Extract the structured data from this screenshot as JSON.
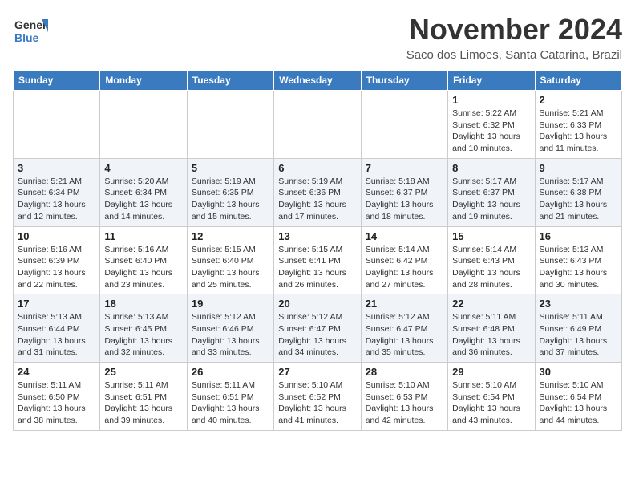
{
  "header": {
    "logo_line1": "General",
    "logo_line2": "Blue",
    "month_year": "November 2024",
    "location": "Saco dos Limoes, Santa Catarina, Brazil"
  },
  "days_of_week": [
    "Sunday",
    "Monday",
    "Tuesday",
    "Wednesday",
    "Thursday",
    "Friday",
    "Saturday"
  ],
  "weeks": [
    [
      {
        "day": "",
        "info": ""
      },
      {
        "day": "",
        "info": ""
      },
      {
        "day": "",
        "info": ""
      },
      {
        "day": "",
        "info": ""
      },
      {
        "day": "",
        "info": ""
      },
      {
        "day": "1",
        "info": "Sunrise: 5:22 AM\nSunset: 6:32 PM\nDaylight: 13 hours and 10 minutes."
      },
      {
        "day": "2",
        "info": "Sunrise: 5:21 AM\nSunset: 6:33 PM\nDaylight: 13 hours and 11 minutes."
      }
    ],
    [
      {
        "day": "3",
        "info": "Sunrise: 5:21 AM\nSunset: 6:34 PM\nDaylight: 13 hours and 12 minutes."
      },
      {
        "day": "4",
        "info": "Sunrise: 5:20 AM\nSunset: 6:34 PM\nDaylight: 13 hours and 14 minutes."
      },
      {
        "day": "5",
        "info": "Sunrise: 5:19 AM\nSunset: 6:35 PM\nDaylight: 13 hours and 15 minutes."
      },
      {
        "day": "6",
        "info": "Sunrise: 5:19 AM\nSunset: 6:36 PM\nDaylight: 13 hours and 17 minutes."
      },
      {
        "day": "7",
        "info": "Sunrise: 5:18 AM\nSunset: 6:37 PM\nDaylight: 13 hours and 18 minutes."
      },
      {
        "day": "8",
        "info": "Sunrise: 5:17 AM\nSunset: 6:37 PM\nDaylight: 13 hours and 19 minutes."
      },
      {
        "day": "9",
        "info": "Sunrise: 5:17 AM\nSunset: 6:38 PM\nDaylight: 13 hours and 21 minutes."
      }
    ],
    [
      {
        "day": "10",
        "info": "Sunrise: 5:16 AM\nSunset: 6:39 PM\nDaylight: 13 hours and 22 minutes."
      },
      {
        "day": "11",
        "info": "Sunrise: 5:16 AM\nSunset: 6:40 PM\nDaylight: 13 hours and 23 minutes."
      },
      {
        "day": "12",
        "info": "Sunrise: 5:15 AM\nSunset: 6:40 PM\nDaylight: 13 hours and 25 minutes."
      },
      {
        "day": "13",
        "info": "Sunrise: 5:15 AM\nSunset: 6:41 PM\nDaylight: 13 hours and 26 minutes."
      },
      {
        "day": "14",
        "info": "Sunrise: 5:14 AM\nSunset: 6:42 PM\nDaylight: 13 hours and 27 minutes."
      },
      {
        "day": "15",
        "info": "Sunrise: 5:14 AM\nSunset: 6:43 PM\nDaylight: 13 hours and 28 minutes."
      },
      {
        "day": "16",
        "info": "Sunrise: 5:13 AM\nSunset: 6:43 PM\nDaylight: 13 hours and 30 minutes."
      }
    ],
    [
      {
        "day": "17",
        "info": "Sunrise: 5:13 AM\nSunset: 6:44 PM\nDaylight: 13 hours and 31 minutes."
      },
      {
        "day": "18",
        "info": "Sunrise: 5:13 AM\nSunset: 6:45 PM\nDaylight: 13 hours and 32 minutes."
      },
      {
        "day": "19",
        "info": "Sunrise: 5:12 AM\nSunset: 6:46 PM\nDaylight: 13 hours and 33 minutes."
      },
      {
        "day": "20",
        "info": "Sunrise: 5:12 AM\nSunset: 6:47 PM\nDaylight: 13 hours and 34 minutes."
      },
      {
        "day": "21",
        "info": "Sunrise: 5:12 AM\nSunset: 6:47 PM\nDaylight: 13 hours and 35 minutes."
      },
      {
        "day": "22",
        "info": "Sunrise: 5:11 AM\nSunset: 6:48 PM\nDaylight: 13 hours and 36 minutes."
      },
      {
        "day": "23",
        "info": "Sunrise: 5:11 AM\nSunset: 6:49 PM\nDaylight: 13 hours and 37 minutes."
      }
    ],
    [
      {
        "day": "24",
        "info": "Sunrise: 5:11 AM\nSunset: 6:50 PM\nDaylight: 13 hours and 38 minutes."
      },
      {
        "day": "25",
        "info": "Sunrise: 5:11 AM\nSunset: 6:51 PM\nDaylight: 13 hours and 39 minutes."
      },
      {
        "day": "26",
        "info": "Sunrise: 5:11 AM\nSunset: 6:51 PM\nDaylight: 13 hours and 40 minutes."
      },
      {
        "day": "27",
        "info": "Sunrise: 5:10 AM\nSunset: 6:52 PM\nDaylight: 13 hours and 41 minutes."
      },
      {
        "day": "28",
        "info": "Sunrise: 5:10 AM\nSunset: 6:53 PM\nDaylight: 13 hours and 42 minutes."
      },
      {
        "day": "29",
        "info": "Sunrise: 5:10 AM\nSunset: 6:54 PM\nDaylight: 13 hours and 43 minutes."
      },
      {
        "day": "30",
        "info": "Sunrise: 5:10 AM\nSunset: 6:54 PM\nDaylight: 13 hours and 44 minutes."
      }
    ]
  ]
}
